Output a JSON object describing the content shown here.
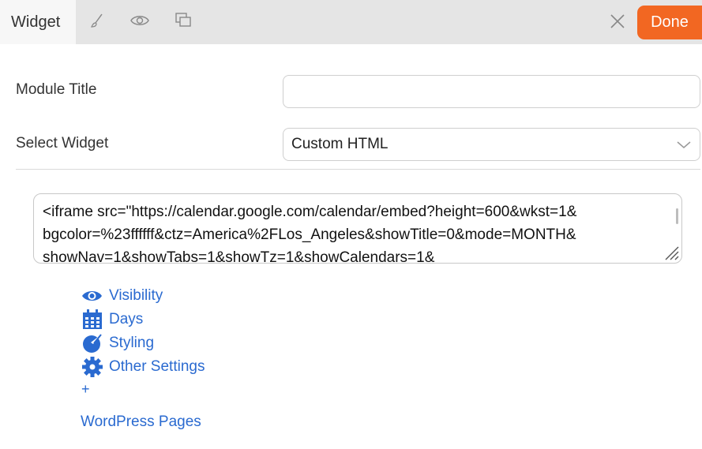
{
  "header": {
    "tab_label": "Widget",
    "done_label": "Done",
    "tools": [
      "brush-icon",
      "eye-icon",
      "layers-icon"
    ],
    "close_icon": "close-icon",
    "accent_color": "#f26722"
  },
  "form": {
    "module_title_label": "Module Title",
    "module_title_value": "",
    "select_widget_label": "Select Widget",
    "select_widget_value": "Custom HTML"
  },
  "code": {
    "lines": [
      "<iframe src=\"https://calendar.google.com/calendar/embed?height=600&wkst=1&",
      "bgcolor=%23ffffff&ctz=America%2FLos_Angeles&showTitle=0&mode=MONTH&",
      "showNav=1&showTabs=1&showTz=1&showCalendars=1&"
    ]
  },
  "sections": {
    "items": [
      {
        "label": "Visibility",
        "icon": "eye-icon"
      },
      {
        "label": "Days",
        "icon": "calendar-icon"
      },
      {
        "label": "Styling",
        "icon": "palette-icon"
      },
      {
        "label": "Other Settings",
        "icon": "gear-icon"
      }
    ],
    "plus": "+",
    "wordpress_pages": "WordPress Pages",
    "link_color": "#2a6ad0"
  }
}
